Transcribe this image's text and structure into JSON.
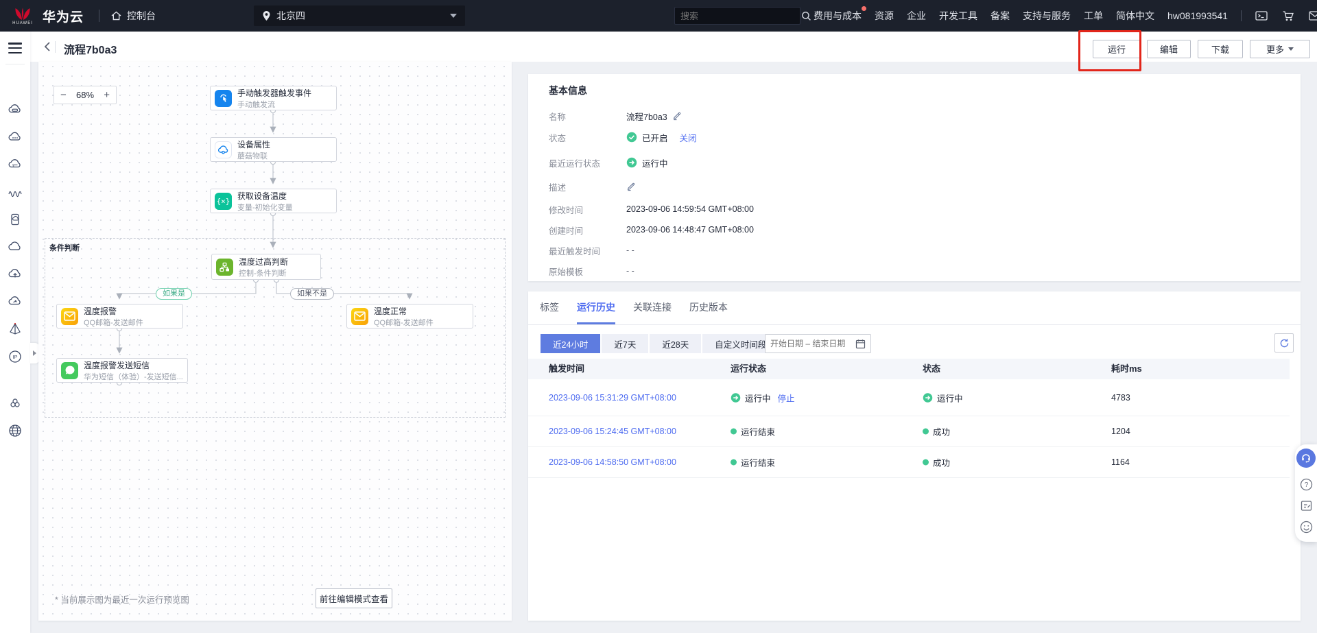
{
  "colors": {
    "topnav_bg": "#1c212c",
    "accent_blue": "#5e7ce0",
    "link_blue": "#4d6bf0",
    "success_green": "#41c893",
    "annotation_red": "#e2251a",
    "node_blue": "#1584ee",
    "node_teal": "#0bc39a",
    "node_green": "#6cb52d",
    "node_yellow": "#f9b908",
    "node_message_green": "#44ca5e"
  },
  "topnav": {
    "brand": "华为云",
    "brand_sub": "HUAWEI",
    "console": "控制台",
    "region": "北京四",
    "search_placeholder": "搜索",
    "menu": [
      "费用与成本",
      "资源",
      "企业",
      "开发工具",
      "备案",
      "支持与服务",
      "工单",
      "简体中文",
      "hw081993541"
    ]
  },
  "titlebar": {
    "title": "流程7b0a3",
    "run": "运行",
    "edit": "编辑",
    "download": "下载",
    "more": "更多"
  },
  "flow": {
    "zoom_out": "−",
    "zoom_level": "68%",
    "zoom_in": "+",
    "group_label": "条件判断",
    "branch_yes": "如果是",
    "branch_no": "如果不是",
    "variable_glyph": "{×}",
    "nodes": [
      {
        "title": "手动触发器触发事件",
        "subtitle": "手动触发流"
      },
      {
        "title": "设备属性",
        "subtitle": "蘑菇物联"
      },
      {
        "title": "获取设备温度",
        "subtitle": "变量-初始化变量"
      },
      {
        "title": "温度过高判断",
        "subtitle": "控制-条件判断"
      },
      {
        "title": "温度报警",
        "subtitle": "QQ邮箱-发送邮件"
      },
      {
        "title": "温度正常",
        "subtitle": "QQ邮箱-发送邮件"
      },
      {
        "title": "温度报警发送短信",
        "subtitle": "华为短信（体验）-发送短信..."
      }
    ],
    "footnote": "* 当前展示图为最近一次运行预览图",
    "goto_edit": "前往编辑模式查看"
  },
  "info": {
    "title": "基本信息",
    "name_label": "名称",
    "name_value": "流程7b0a3",
    "status_label": "状态",
    "status_value": "已开启",
    "status_link": "关闭",
    "run_status_label": "最近运行状态",
    "run_status_value": "运行中",
    "desc_label": "描述",
    "modified_label": "修改时间",
    "modified_value": "2023-09-06 14:59:54 GMT+08:00",
    "created_label": "创建时间",
    "created_value": "2023-09-06 14:48:47 GMT+08:00",
    "last_trigger_label": "最近触发时间",
    "last_trigger_value": "- -",
    "template_label": "原始模板",
    "template_value": "- -"
  },
  "tabs": {
    "items": [
      "标签",
      "运行历史",
      "关联连接",
      "历史版本"
    ],
    "active": "运行历史"
  },
  "filters": {
    "r0": "近24小时",
    "r1": "近7天",
    "r2": "近28天",
    "r3": "自定义时间段",
    "date_placeholder": "开始日期 – 结束日期"
  },
  "table": {
    "h0": "触发时间",
    "h1": "运行状态",
    "h2": "状态",
    "h3": "耗时ms",
    "rows": [
      {
        "time": "2023-09-06 15:31:29 GMT+08:00",
        "run_status": "运行中",
        "stop_link": "停止",
        "status": "运行中",
        "duration": "4783"
      },
      {
        "time": "2023-09-06 15:24:45 GMT+08:00",
        "run_status": "运行结束",
        "status": "成功",
        "duration": "1204"
      },
      {
        "time": "2023-09-06 14:58:50 GMT+08:00",
        "run_status": "运行结束",
        "status": "成功",
        "duration": "1164"
      }
    ]
  }
}
